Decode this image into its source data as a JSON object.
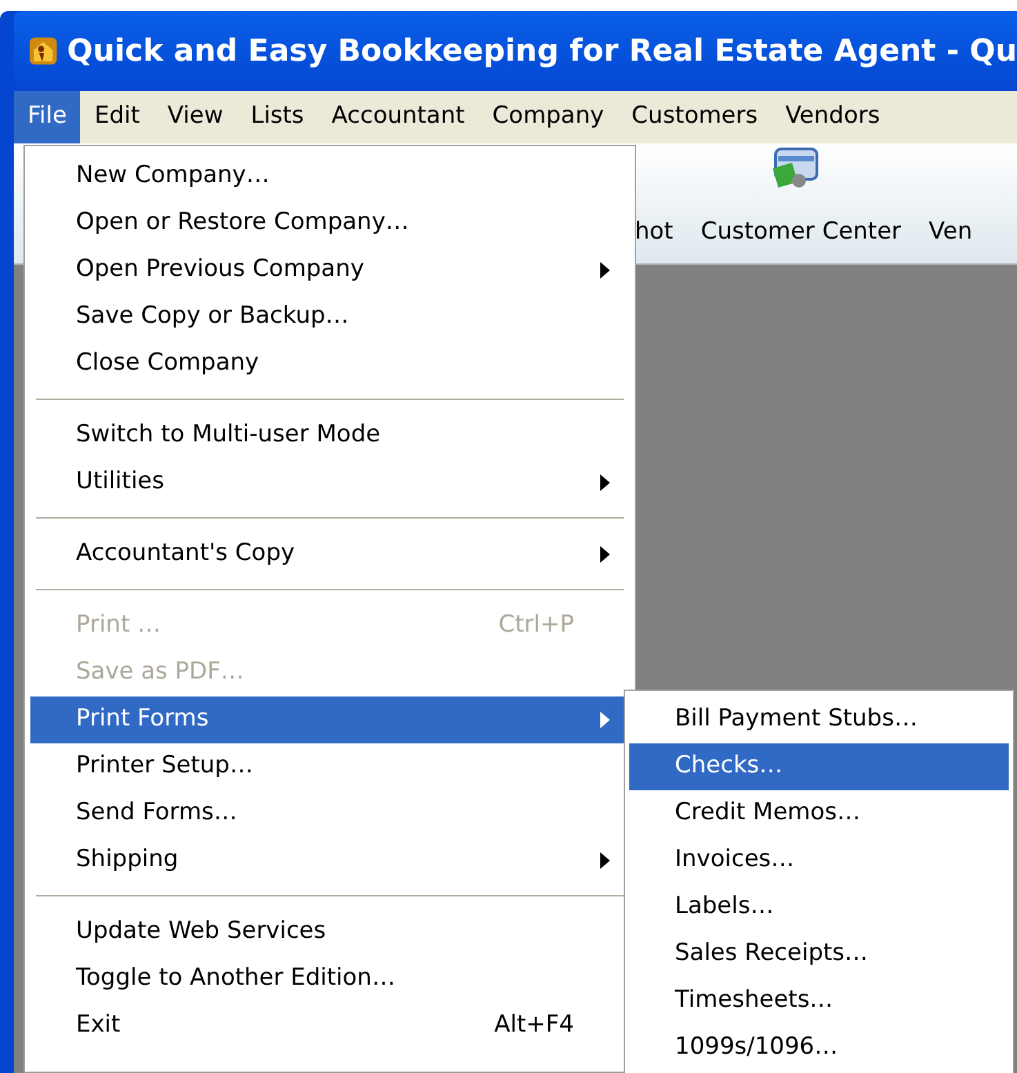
{
  "window": {
    "title": "Quick and Easy Bookkeeping for Real Estate Agent  - Qu"
  },
  "menu_bar": [
    {
      "label": "File",
      "selected": true
    },
    {
      "label": "Edit",
      "selected": false
    },
    {
      "label": "View",
      "selected": false
    },
    {
      "label": "Lists",
      "selected": false
    },
    {
      "label": "Accountant",
      "selected": false
    },
    {
      "label": "Company",
      "selected": false
    },
    {
      "label": "Customers",
      "selected": false
    },
    {
      "label": "Vendors",
      "selected": false
    }
  ],
  "toolbar": {
    "items": [
      {
        "label": "hot"
      },
      {
        "label": "Customer Center"
      },
      {
        "label": "Ven"
      }
    ]
  },
  "file_menu": [
    {
      "kind": "item",
      "label": "New Company…",
      "disabled": false,
      "selected": false,
      "submenu": false
    },
    {
      "kind": "item",
      "label": "Open or Restore Company…",
      "disabled": false,
      "selected": false,
      "submenu": false
    },
    {
      "kind": "item",
      "label": "Open Previous Company",
      "disabled": false,
      "selected": false,
      "submenu": true
    },
    {
      "kind": "item",
      "label": "Save Copy or Backup…",
      "disabled": false,
      "selected": false,
      "submenu": false
    },
    {
      "kind": "item",
      "label": "Close Company",
      "disabled": false,
      "selected": false,
      "submenu": false
    },
    {
      "kind": "separator"
    },
    {
      "kind": "item",
      "label": "Switch to Multi-user Mode",
      "disabled": false,
      "selected": false,
      "submenu": false
    },
    {
      "kind": "item",
      "label": "Utilities",
      "disabled": false,
      "selected": false,
      "submenu": true
    },
    {
      "kind": "separator"
    },
    {
      "kind": "item",
      "label": "Accountant's Copy",
      "disabled": false,
      "selected": false,
      "submenu": true
    },
    {
      "kind": "separator"
    },
    {
      "kind": "item",
      "label": "Print …",
      "shortcut": "Ctrl+P",
      "disabled": true,
      "selected": false,
      "submenu": false
    },
    {
      "kind": "item",
      "label": "Save as PDF…",
      "disabled": true,
      "selected": false,
      "submenu": false
    },
    {
      "kind": "item",
      "label": "Print Forms",
      "disabled": false,
      "selected": true,
      "submenu": true
    },
    {
      "kind": "item",
      "label": "Printer Setup…",
      "disabled": false,
      "selected": false,
      "submenu": false
    },
    {
      "kind": "item",
      "label": "Send Forms…",
      "disabled": false,
      "selected": false,
      "submenu": false
    },
    {
      "kind": "item",
      "label": "Shipping",
      "disabled": false,
      "selected": false,
      "submenu": true
    },
    {
      "kind": "separator"
    },
    {
      "kind": "item",
      "label": "Update Web Services",
      "disabled": false,
      "selected": false,
      "submenu": false
    },
    {
      "kind": "item",
      "label": "Toggle to Another Edition…",
      "disabled": false,
      "selected": false,
      "submenu": false
    },
    {
      "kind": "item",
      "label": "Exit",
      "shortcut": "Alt+F4",
      "disabled": false,
      "selected": false,
      "submenu": false
    }
  ],
  "print_forms_submenu": [
    {
      "label": "Bill Payment Stubs…",
      "selected": false
    },
    {
      "label": "Checks…",
      "selected": true
    },
    {
      "label": "Credit Memos…",
      "selected": false
    },
    {
      "label": "Invoices…",
      "selected": false
    },
    {
      "label": "Labels…",
      "selected": false
    },
    {
      "label": "Sales Receipts…",
      "selected": false
    },
    {
      "label": "Timesheets…",
      "selected": false
    },
    {
      "label": "1099s/1096…",
      "selected": false
    }
  ]
}
